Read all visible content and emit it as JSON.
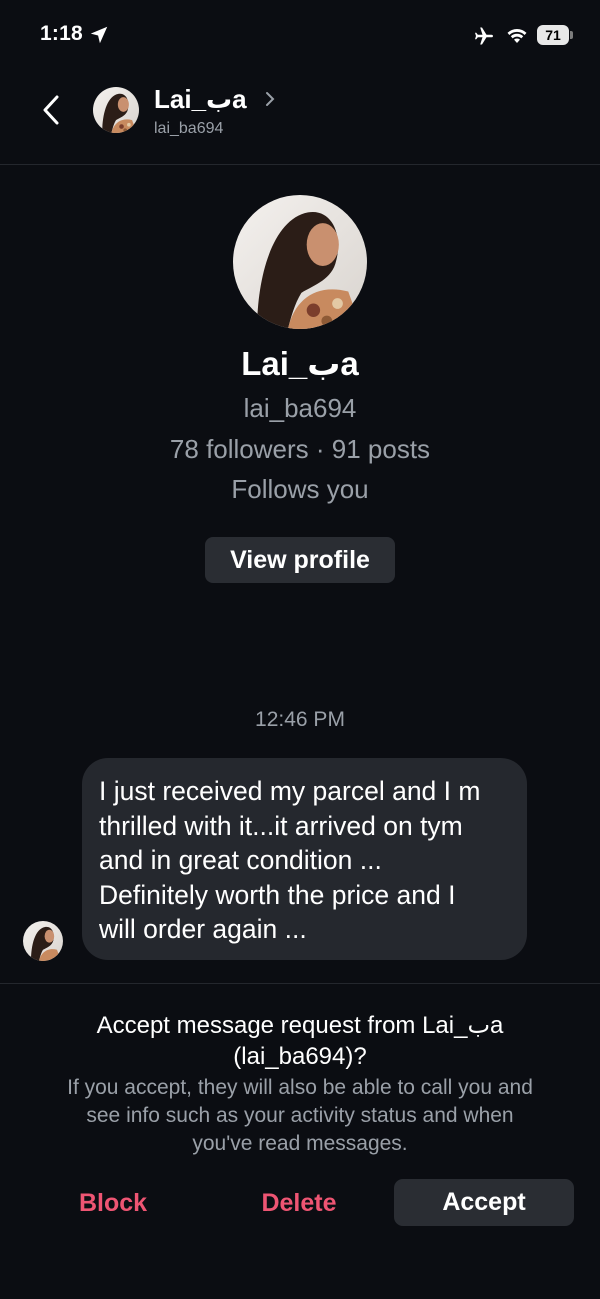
{
  "status_bar": {
    "time": "1:18",
    "battery": "71"
  },
  "header": {
    "name": "Lai_بa",
    "username": "lai_ba694"
  },
  "profile": {
    "name": "Lai_بa",
    "username": "lai_ba694",
    "stats": "78 followers · 91 posts",
    "follows_you": "Follows you",
    "view_profile_label": "View profile"
  },
  "conversation": {
    "timestamp": "12:46 PM",
    "message_lines": [
      "I just received my parcel and I m",
      "thrilled with it...it arrived on tym",
      "and in great condition ...",
      "Definitely worth the price and I",
      "will order again ..."
    ]
  },
  "request": {
    "title_line1": "Accept message request from Lai_بa",
    "title_line2": "(lai_ba694)?",
    "body_line1": "If you accept, they will also be able to call you and",
    "body_line2": "see info such as your activity status and when",
    "body_line3": "you've read messages.",
    "block_label": "Block",
    "delete_label": "Delete",
    "accept_label": "Accept"
  },
  "colors": {
    "background": "#0b0d12",
    "danger": "#ee5573",
    "muted": "#9aa0a8",
    "bubble": "#25282e"
  },
  "icons": [
    "location-arrow-icon",
    "airplane-icon",
    "wifi-icon",
    "battery-icon",
    "back-chevron-icon",
    "chevron-right-icon"
  ]
}
